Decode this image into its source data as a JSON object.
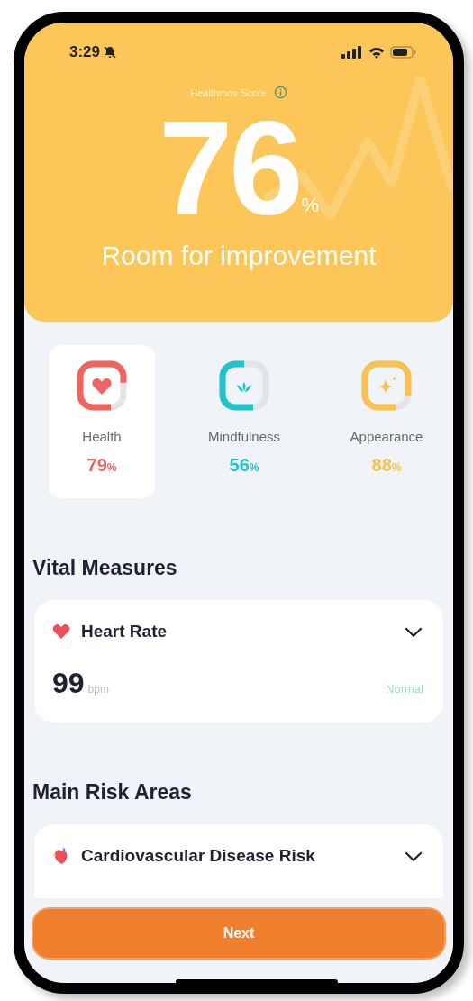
{
  "status_bar": {
    "time": "3:29"
  },
  "score": {
    "label": "Healthmov Score",
    "value": "76",
    "unit": "%",
    "verdict": "Room for improvement"
  },
  "categories": [
    {
      "label": "Health",
      "value": "79",
      "unit": "%",
      "color": "#ee6461",
      "selected": true
    },
    {
      "label": "Mindfulness",
      "value": "56",
      "unit": "%",
      "color": "#22c4cc",
      "selected": false
    },
    {
      "label": "Appearance",
      "value": "88",
      "unit": "%",
      "color": "#f8c250",
      "selected": false
    }
  ],
  "vital_measures": {
    "title": "Vital Measures",
    "items": [
      {
        "name": "Heart Rate",
        "kind": "heart",
        "value": "99",
        "unit": "bpm",
        "status": "Normal",
        "expanded": false
      }
    ]
  },
  "risk_areas": {
    "title": "Main Risk Areas",
    "items": [
      {
        "name": "Cardiovascular Disease Risk",
        "kind": "organ",
        "expanded": false
      }
    ]
  },
  "next_button": "Next"
}
